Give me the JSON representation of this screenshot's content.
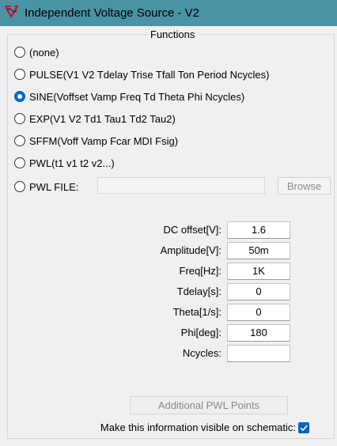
{
  "window": {
    "title": "Independent Voltage Source - V2"
  },
  "functions": {
    "group_label": "Functions",
    "options": [
      {
        "label": "(none)",
        "selected": false
      },
      {
        "label": "PULSE(V1 V2 Tdelay Trise Tfall Ton Period Ncycles)",
        "selected": false
      },
      {
        "label": "SINE(Voffset Vamp Freq Td Theta Phi Ncycles)",
        "selected": true
      },
      {
        "label": "EXP(V1 V2 Td1 Tau1 Td2 Tau2)",
        "selected": false
      },
      {
        "label": "SFFM(Voff Vamp Fcar MDI Fsig)",
        "selected": false
      },
      {
        "label": "PWL(t1 v1 t2 v2...)",
        "selected": false
      },
      {
        "label": "PWL FILE:",
        "selected": false
      }
    ],
    "pwl_file_value": "",
    "browse_label": "Browse"
  },
  "params": [
    {
      "label": "DC offset[V]:",
      "value": "1.6"
    },
    {
      "label": "Amplitude[V]:",
      "value": "50m"
    },
    {
      "label": "Freq[Hz]:",
      "value": "1K"
    },
    {
      "label": "Tdelay[s]:",
      "value": "0"
    },
    {
      "label": "Theta[1/s]:",
      "value": "0"
    },
    {
      "label": "Phi[deg]:",
      "value": "180"
    },
    {
      "label": "Ncycles:",
      "value": ""
    }
  ],
  "additional_pwl_label": "Additional PWL Points",
  "visible_on_schematic": {
    "label": "Make this information visible on schematic:",
    "checked": true
  },
  "colors": {
    "titlebar": "#4a93a4",
    "accent": "#0067c0",
    "disabled_text": "#8a8a8a"
  }
}
